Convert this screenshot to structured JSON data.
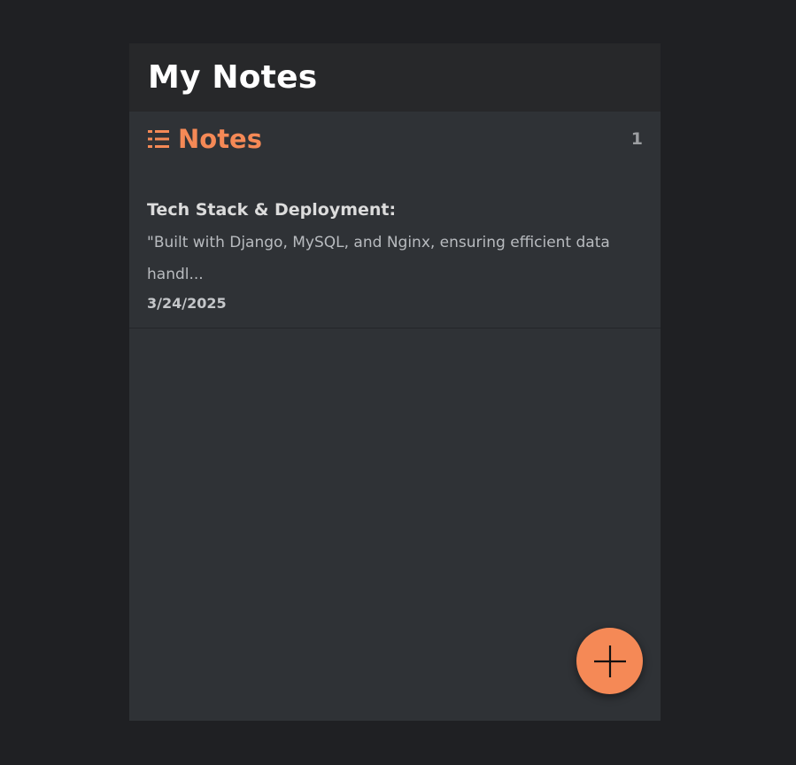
{
  "app": {
    "title": "My Notes"
  },
  "notes_section": {
    "heading": "Notes",
    "count": "1",
    "icon": "list-icon",
    "accent_color": "#f58956"
  },
  "notes": [
    {
      "title": "Tech Stack & Deployment:",
      "preview": "\"Built with Django, MySQL, and Nginx, ensuring efficient data handl...",
      "date": "3/24/2025"
    }
  ],
  "fab": {
    "icon": "plus-icon"
  }
}
